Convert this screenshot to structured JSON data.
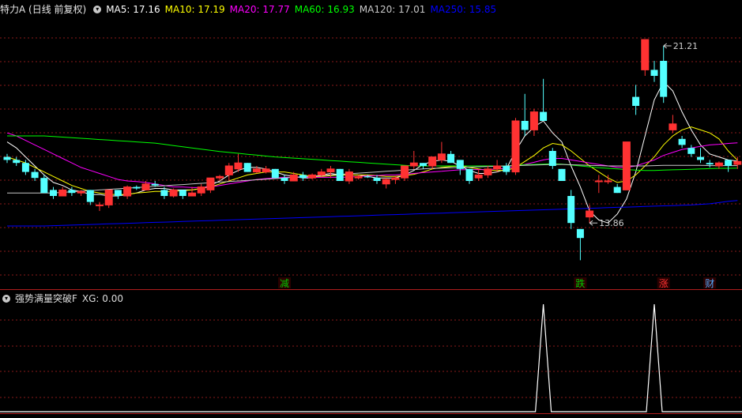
{
  "header": {
    "title": "特力A (日线 前复权)",
    "ma_items": [
      {
        "label": "MA5: 17.16",
        "color": "#ffffff"
      },
      {
        "label": "MA10: 17.19",
        "color": "#ffff00"
      },
      {
        "label": "MA20: 17.77",
        "color": "#ff00ff"
      },
      {
        "label": "MA60: 16.93",
        "color": "#00ff00"
      },
      {
        "label": "MA120: 17.01",
        "color": "#c8c8c8"
      },
      {
        "label": "MA250: 15.85",
        "color": "#0000ff"
      }
    ]
  },
  "indicator": {
    "label": "强势满量突破F",
    "value_label": "XG: 0.00"
  },
  "chart_data": [
    {
      "type": "candlestick",
      "title": "特力A (日线 前复权)",
      "ylim": [
        13.0,
        22.0
      ],
      "max_label": "21.21",
      "min_label": "13.86",
      "max_index": 71,
      "min_index": 63,
      "up_color": "#ff3232",
      "down_color": "#54ffff",
      "candles": [
        [
          17.3,
          17.4,
          17.1,
          17.2
        ],
        [
          17.2,
          17.3,
          17.0,
          17.1
        ],
        [
          17.1,
          17.2,
          16.7,
          16.8
        ],
        [
          16.8,
          16.9,
          16.5,
          16.6
        ],
        [
          16.6,
          16.7,
          16.1,
          16.1
        ],
        [
          16.2,
          16.3,
          15.9,
          16.0
        ],
        [
          16.0,
          16.3,
          16.0,
          16.2
        ],
        [
          16.2,
          16.3,
          16.0,
          16.1
        ],
        [
          16.1,
          16.2,
          16.0,
          16.15
        ],
        [
          16.2,
          16.2,
          15.7,
          15.8
        ],
        [
          15.7,
          15.8,
          15.5,
          15.7
        ],
        [
          15.7,
          16.2,
          15.6,
          16.2
        ],
        [
          16.2,
          16.2,
          15.9,
          16.0
        ],
        [
          16.0,
          16.35,
          15.9,
          16.3
        ],
        [
          16.3,
          16.35,
          16.2,
          16.25
        ],
        [
          16.2,
          16.5,
          16.2,
          16.4
        ],
        [
          16.4,
          16.5,
          16.3,
          16.35
        ],
        [
          16.2,
          16.3,
          15.9,
          16.0
        ],
        [
          16.0,
          16.25,
          15.95,
          16.2
        ],
        [
          16.2,
          16.2,
          15.9,
          16.0
        ],
        [
          16.0,
          16.3,
          16.0,
          16.1
        ],
        [
          16.1,
          16.4,
          16.0,
          16.3
        ],
        [
          16.2,
          16.6,
          16.1,
          16.6
        ],
        [
          16.6,
          16.7,
          16.5,
          16.65
        ],
        [
          16.7,
          17.1,
          16.5,
          17.0
        ],
        [
          16.9,
          17.4,
          16.8,
          17.1
        ],
        [
          17.1,
          17.1,
          16.8,
          16.8
        ],
        [
          16.8,
          17.0,
          16.75,
          16.9
        ],
        [
          16.8,
          17.0,
          16.75,
          16.9
        ],
        [
          16.9,
          16.9,
          16.6,
          16.6
        ],
        [
          16.6,
          16.7,
          16.4,
          16.5
        ],
        [
          16.5,
          16.8,
          16.5,
          16.7
        ],
        [
          16.7,
          16.8,
          16.5,
          16.6
        ],
        [
          16.6,
          16.75,
          16.55,
          16.7
        ],
        [
          16.7,
          16.9,
          16.65,
          16.8
        ],
        [
          16.8,
          17.0,
          16.6,
          16.9
        ],
        [
          16.9,
          16.9,
          16.5,
          16.5
        ],
        [
          16.5,
          16.9,
          16.4,
          16.8
        ],
        [
          16.6,
          16.7,
          16.55,
          16.65
        ],
        [
          16.65,
          16.7,
          16.6,
          16.62
        ],
        [
          16.6,
          16.7,
          16.4,
          16.5
        ],
        [
          16.4,
          16.6,
          16.25,
          16.55
        ],
        [
          16.55,
          16.65,
          16.4,
          16.6
        ],
        [
          16.6,
          17.0,
          16.5,
          17.0
        ],
        [
          17.0,
          17.5,
          16.9,
          17.1
        ],
        [
          17.1,
          17.1,
          16.9,
          17.0
        ],
        [
          17.0,
          17.3,
          16.9,
          17.3
        ],
        [
          17.2,
          17.8,
          17.1,
          17.4
        ],
        [
          17.4,
          17.5,
          17.1,
          17.1
        ],
        [
          17.2,
          17.1,
          16.7,
          16.9
        ],
        [
          16.9,
          16.9,
          16.4,
          16.5
        ],
        [
          16.6,
          16.9,
          16.5,
          16.7
        ],
        [
          16.7,
          17.0,
          16.6,
          16.9
        ],
        [
          16.9,
          17.2,
          16.8,
          17.0
        ],
        [
          17.0,
          17.1,
          16.7,
          16.8
        ],
        [
          16.8,
          18.6,
          16.7,
          18.5
        ],
        [
          18.5,
          19.4,
          18.0,
          18.2
        ],
        [
          18.2,
          18.9,
          18.0,
          18.8
        ],
        [
          18.8,
          19.9,
          18.7,
          18.5
        ],
        [
          17.5,
          17.6,
          16.9,
          17.0
        ],
        [
          16.9,
          16.9,
          16.5,
          16.5
        ],
        [
          16.0,
          16.2,
          14.9,
          15.1
        ],
        [
          14.9,
          14.9,
          13.86,
          14.6
        ],
        [
          15.3,
          15.7,
          15.1,
          15.5
        ],
        [
          16.5,
          16.7,
          16.1,
          16.5
        ],
        [
          16.5,
          16.7,
          16.4,
          16.5
        ],
        [
          16.3,
          16.4,
          16.1,
          16.1
        ],
        [
          16.2,
          17.8,
          16.2,
          17.8
        ],
        [
          19.3,
          19.7,
          18.7,
          19.0
        ],
        [
          20.2,
          21.21,
          20.0,
          21.21
        ],
        [
          20.2,
          20.5,
          19.8,
          20.0
        ],
        [
          20.5,
          21.0,
          19.1,
          19.3
        ],
        [
          18.2,
          18.7,
          18.1,
          18.4
        ],
        [
          17.9,
          18.0,
          17.6,
          17.7
        ],
        [
          17.6,
          17.7,
          17.3,
          17.4
        ],
        [
          17.3,
          17.6,
          17.1,
          17.2
        ],
        [
          17.1,
          17.2,
          16.95,
          17.05
        ],
        [
          17.0,
          17.15,
          16.9,
          17.1
        ],
        [
          17.2,
          17.2,
          16.8,
          17.0
        ],
        [
          17.05,
          17.3,
          16.9,
          17.15
        ]
      ],
      "ma_lines": [
        {
          "name": "MA5",
          "color": "#ffffff",
          "values": [
            17.8,
            17.6,
            17.3,
            17.0,
            16.7,
            16.45,
            16.35,
            16.2,
            16.15,
            16.05,
            16.05,
            16.0,
            16.0,
            16.05,
            16.1,
            16.2,
            16.25,
            16.25,
            16.2,
            16.2,
            16.2,
            16.25,
            16.35,
            16.5,
            16.7,
            16.85,
            16.95,
            16.95,
            16.9,
            16.8,
            16.7,
            16.65,
            16.6,
            16.6,
            16.7,
            16.75,
            16.7,
            16.7,
            16.7,
            16.65,
            16.6,
            16.6,
            16.6,
            16.7,
            16.85,
            17.05,
            17.15,
            17.2,
            17.15,
            17.0,
            16.85,
            16.75,
            16.75,
            16.8,
            16.9,
            17.5,
            18.0,
            18.3,
            18.5,
            18.1,
            17.8,
            17.0,
            16.3,
            15.5,
            15.2,
            15.1,
            15.4,
            15.9,
            16.8,
            18.0,
            19.2,
            19.8,
            19.5,
            18.8,
            18.2,
            17.7,
            17.4,
            17.3,
            17.2,
            17.16
          ]
        },
        {
          "name": "MA10",
          "color": "#ffff00",
          "values": [
            17.3,
            17.2,
            17.1,
            16.95,
            16.8,
            16.65,
            16.5,
            16.35,
            16.25,
            16.15,
            16.1,
            16.05,
            16.05,
            16.05,
            16.1,
            16.12,
            16.15,
            16.15,
            16.15,
            16.18,
            16.2,
            16.25,
            16.3,
            16.4,
            16.5,
            16.6,
            16.7,
            16.75,
            16.8,
            16.8,
            16.8,
            16.75,
            16.7,
            16.65,
            16.65,
            16.68,
            16.7,
            16.7,
            16.7,
            16.7,
            16.68,
            16.65,
            16.65,
            16.68,
            16.72,
            16.8,
            16.9,
            16.95,
            16.98,
            17.0,
            16.95,
            16.9,
            16.85,
            16.85,
            16.85,
            16.95,
            17.15,
            17.35,
            17.6,
            17.75,
            17.7,
            17.5,
            17.25,
            17.0,
            16.8,
            16.6,
            16.45,
            16.5,
            16.7,
            17.0,
            17.3,
            17.7,
            18.0,
            18.2,
            18.3,
            18.2,
            18.1,
            17.9,
            17.5,
            17.19
          ]
        },
        {
          "name": "MA20",
          "color": "#ff00ff",
          "values": [
            18.1,
            18.0,
            17.85,
            17.7,
            17.55,
            17.4,
            17.25,
            17.1,
            16.95,
            16.85,
            16.75,
            16.65,
            16.55,
            16.5,
            16.48,
            16.45,
            16.4,
            16.35,
            16.3,
            16.3,
            16.28,
            16.28,
            16.3,
            16.35,
            16.4,
            16.45,
            16.5,
            16.55,
            16.58,
            16.6,
            16.62,
            16.62,
            16.62,
            16.62,
            16.62,
            16.62,
            16.62,
            16.63,
            16.65,
            16.67,
            16.68,
            16.7,
            16.7,
            16.72,
            16.75,
            16.78,
            16.8,
            16.82,
            16.85,
            16.87,
            16.88,
            16.88,
            16.88,
            16.9,
            16.92,
            16.98,
            17.05,
            17.12,
            17.2,
            17.25,
            17.25,
            17.2,
            17.15,
            17.1,
            17.05,
            17.0,
            16.95,
            16.95,
            17.0,
            17.1,
            17.2,
            17.35,
            17.45,
            17.55,
            17.6,
            17.65,
            17.7,
            17.72,
            17.75,
            17.77
          ]
        },
        {
          "name": "MA60",
          "color": "#00ff00",
          "values": [
            18.0,
            18.0,
            18.0,
            18.0,
            18.0,
            17.98,
            17.96,
            17.94,
            17.92,
            17.9,
            17.88,
            17.86,
            17.84,
            17.82,
            17.8,
            17.78,
            17.76,
            17.72,
            17.68,
            17.64,
            17.6,
            17.56,
            17.52,
            17.48,
            17.45,
            17.42,
            17.39,
            17.36,
            17.33,
            17.3,
            17.28,
            17.26,
            17.24,
            17.22,
            17.2,
            17.18,
            17.16,
            17.14,
            17.12,
            17.1,
            17.08,
            17.06,
            17.04,
            17.02,
            17.0,
            17.0,
            17.0,
            17.0,
            17.0,
            17.0,
            17.0,
            17.0,
            17.0,
            17.0,
            17.0,
            17.02,
            17.04,
            17.05,
            17.06,
            17.07,
            17.06,
            17.03,
            17.0,
            16.97,
            16.94,
            16.92,
            16.9,
            16.88,
            16.86,
            16.85,
            16.85,
            16.86,
            16.87,
            16.88,
            16.89,
            16.9,
            16.91,
            16.92,
            16.92,
            16.93
          ]
        },
        {
          "name": "MA120",
          "color": "#c8c8c8",
          "values": [
            16.1,
            16.1,
            16.1,
            16.1,
            16.1,
            16.1,
            16.12,
            16.14,
            16.16,
            16.18,
            16.2,
            16.22,
            16.24,
            16.26,
            16.28,
            16.3,
            16.32,
            16.34,
            16.36,
            16.38,
            16.4,
            16.42,
            16.44,
            16.46,
            16.48,
            16.5,
            16.52,
            16.54,
            16.56,
            16.58,
            16.6,
            16.62,
            16.64,
            16.66,
            16.68,
            16.7,
            16.72,
            16.74,
            16.76,
            16.78,
            16.8,
            16.82,
            16.84,
            16.86,
            16.88,
            16.9,
            16.92,
            16.93,
            16.94,
            16.95,
            16.96,
            16.97,
            16.98,
            16.99,
            17.0,
            17.01,
            17.02,
            17.03,
            17.04,
            17.05,
            17.05,
            17.04,
            17.03,
            17.02,
            17.01,
            17.0,
            17.0,
            17.0,
            17.0,
            17.0,
            17.01,
            17.02,
            17.02,
            17.02,
            17.02,
            17.02,
            17.01,
            17.01,
            17.01,
            17.01
          ]
        },
        {
          "name": "MA250",
          "color": "#0000ff",
          "values": [
            15.0,
            15.0,
            15.0,
            15.0,
            15.0,
            15.01,
            15.02,
            15.03,
            15.04,
            15.05,
            15.06,
            15.07,
            15.08,
            15.09,
            15.1,
            15.11,
            15.12,
            15.13,
            15.14,
            15.15,
            15.16,
            15.17,
            15.18,
            15.19,
            15.2,
            15.21,
            15.22,
            15.23,
            15.24,
            15.25,
            15.26,
            15.27,
            15.28,
            15.29,
            15.3,
            15.31,
            15.32,
            15.33,
            15.34,
            15.35,
            15.36,
            15.37,
            15.38,
            15.39,
            15.4,
            15.41,
            15.42,
            15.43,
            15.44,
            15.45,
            15.46,
            15.47,
            15.48,
            15.49,
            15.5,
            15.51,
            15.52,
            15.53,
            15.54,
            15.55,
            15.56,
            15.57,
            15.58,
            15.59,
            15.6,
            15.61,
            15.62,
            15.63,
            15.64,
            15.65,
            15.66,
            15.67,
            15.68,
            15.69,
            15.7,
            15.72,
            15.74,
            15.78,
            15.82,
            15.85
          ]
        }
      ],
      "markers": [
        {
          "index": 30,
          "label": "减",
          "color": "#00cc00"
        },
        {
          "index": 62,
          "label": "跌",
          "color": "#00cc00"
        },
        {
          "index": 71,
          "label": "涨",
          "color": "#ff3232"
        },
        {
          "index": 76,
          "label": "财",
          "color": "#54aaff"
        }
      ]
    },
    {
      "type": "line",
      "title": "强势满量突破F",
      "series": [
        {
          "name": "XG",
          "color": "#ffffff",
          "spikes_at": [
            58,
            70
          ],
          "values": "0 everywhere except 1 at spike indices"
        }
      ],
      "ylim": [
        0,
        1
      ]
    }
  ]
}
